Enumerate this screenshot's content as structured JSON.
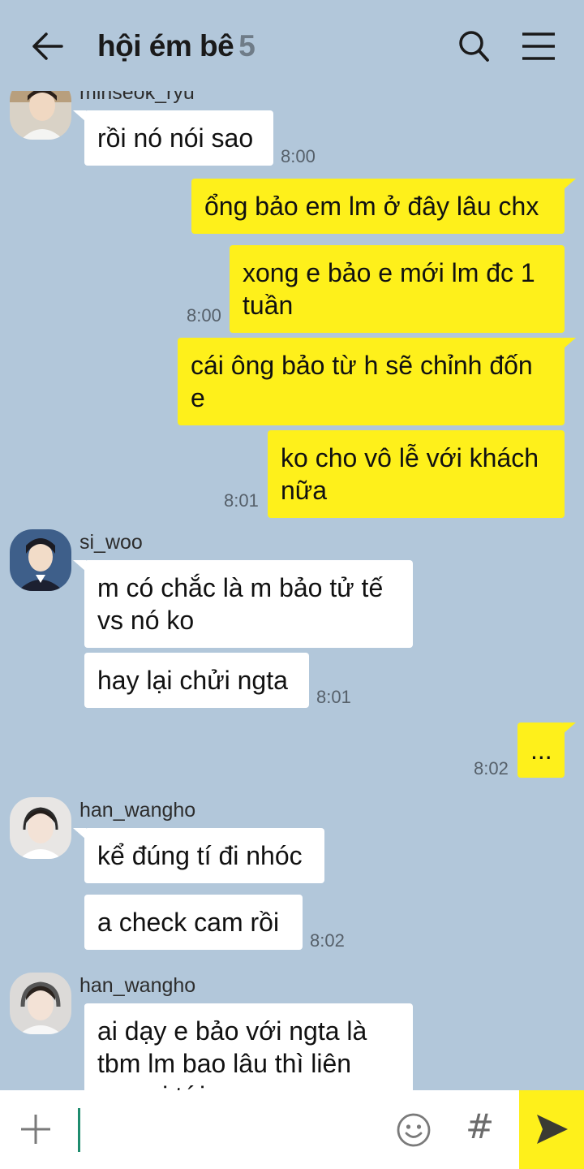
{
  "header": {
    "title": "hội ém bê",
    "member_count": "5",
    "icons": [
      "back-arrow-icon",
      "search-icon",
      "menu-icon"
    ]
  },
  "messages": [
    {
      "sender": "minseok_ryu",
      "text": "rồi nó nói sao",
      "time": "8:00",
      "direction": "in"
    },
    {
      "text": "ổng bảo em lm ở đây lâu chx",
      "direction": "out"
    },
    {
      "text": "xong e bảo e mới lm đc 1 tuần",
      "time": "8:00",
      "direction": "out"
    },
    {
      "text": "cái ông bảo từ h sẽ chỉnh đốn e",
      "direction": "out"
    },
    {
      "text": "ko cho vô lễ với khách nữa",
      "time": "8:01",
      "direction": "out"
    },
    {
      "sender": "si_woo",
      "text": "m có chắc là m bảo tử tế vs nó ko",
      "direction": "in"
    },
    {
      "text": "hay lại chửi ngta",
      "time": "8:01",
      "direction": "in"
    },
    {
      "text": "...",
      "time": "8:02",
      "direction": "out"
    },
    {
      "sender": "han_wangho",
      "text": "kể đúng tí đi nhóc",
      "direction": "in"
    },
    {
      "text": "a check cam rồi",
      "time": "8:02",
      "direction": "in"
    },
    {
      "sender": "han_wangho",
      "text": "ai dạy e bảo với ngta là tbm lm bao lâu thì liên quan j tới m",
      "direction": "in"
    }
  ],
  "input_bar": {
    "value": "",
    "hash_label": "#",
    "icons": [
      "plus-icon",
      "emoji-icon",
      "hash-icon",
      "send-icon"
    ]
  },
  "colors": {
    "background": "#b2c7da",
    "outgoing_bubble": "#fef01b",
    "incoming_bubble": "#ffffff",
    "send_button": "#fef01b",
    "cursor": "#1f8c6e"
  }
}
